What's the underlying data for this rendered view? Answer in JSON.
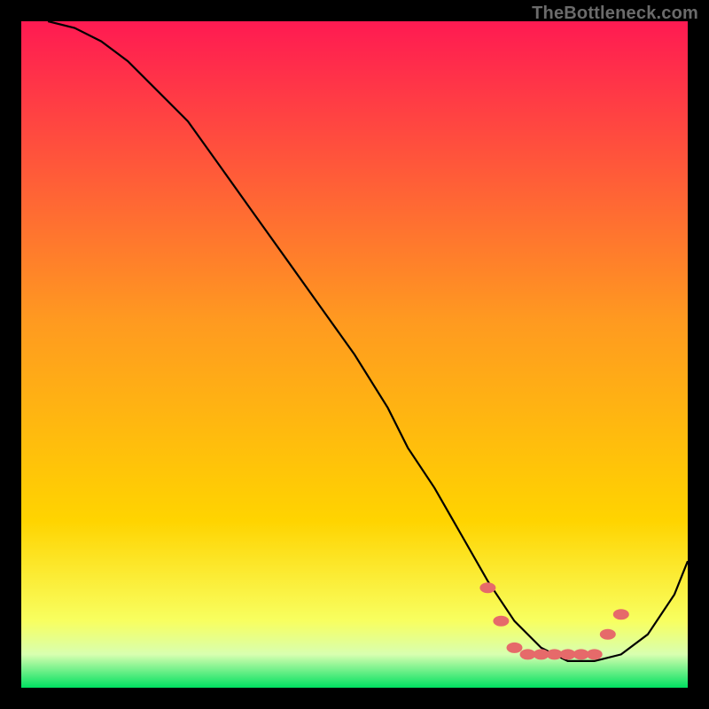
{
  "watermark": "TheBottleneck.com",
  "chart_data": {
    "type": "line",
    "title": "",
    "xlabel": "",
    "ylabel": "",
    "xrange": [
      0,
      100
    ],
    "yrange": [
      0,
      100
    ],
    "grid": false,
    "legend": false,
    "background_gradient": {
      "top_color": "#ff1a52",
      "mid_color": "#ffd400",
      "bottom_color": "#00e060",
      "transition_to_green_at_pct": 95
    },
    "series": [
      {
        "name": "bottleneck-curve",
        "color": "#000000",
        "x": [
          4,
          8,
          12,
          16,
          20,
          25,
          30,
          35,
          40,
          45,
          50,
          55,
          58,
          62,
          66,
          70,
          74,
          78,
          82,
          86,
          90,
          94,
          98,
          100
        ],
        "y": [
          100,
          99,
          97,
          94,
          90,
          85,
          78,
          71,
          64,
          57,
          50,
          42,
          36,
          30,
          23,
          16,
          10,
          6,
          4,
          4,
          5,
          8,
          14,
          19
        ]
      }
    ],
    "markers": {
      "name": "optimal-region-dots",
      "color": "#e66a6a",
      "points": [
        {
          "x": 70,
          "y": 15
        },
        {
          "x": 72,
          "y": 10
        },
        {
          "x": 74,
          "y": 6
        },
        {
          "x": 76,
          "y": 5
        },
        {
          "x": 78,
          "y": 5
        },
        {
          "x": 80,
          "y": 5
        },
        {
          "x": 82,
          "y": 5
        },
        {
          "x": 84,
          "y": 5
        },
        {
          "x": 86,
          "y": 5
        },
        {
          "x": 88,
          "y": 8
        },
        {
          "x": 90,
          "y": 11
        }
      ]
    }
  }
}
